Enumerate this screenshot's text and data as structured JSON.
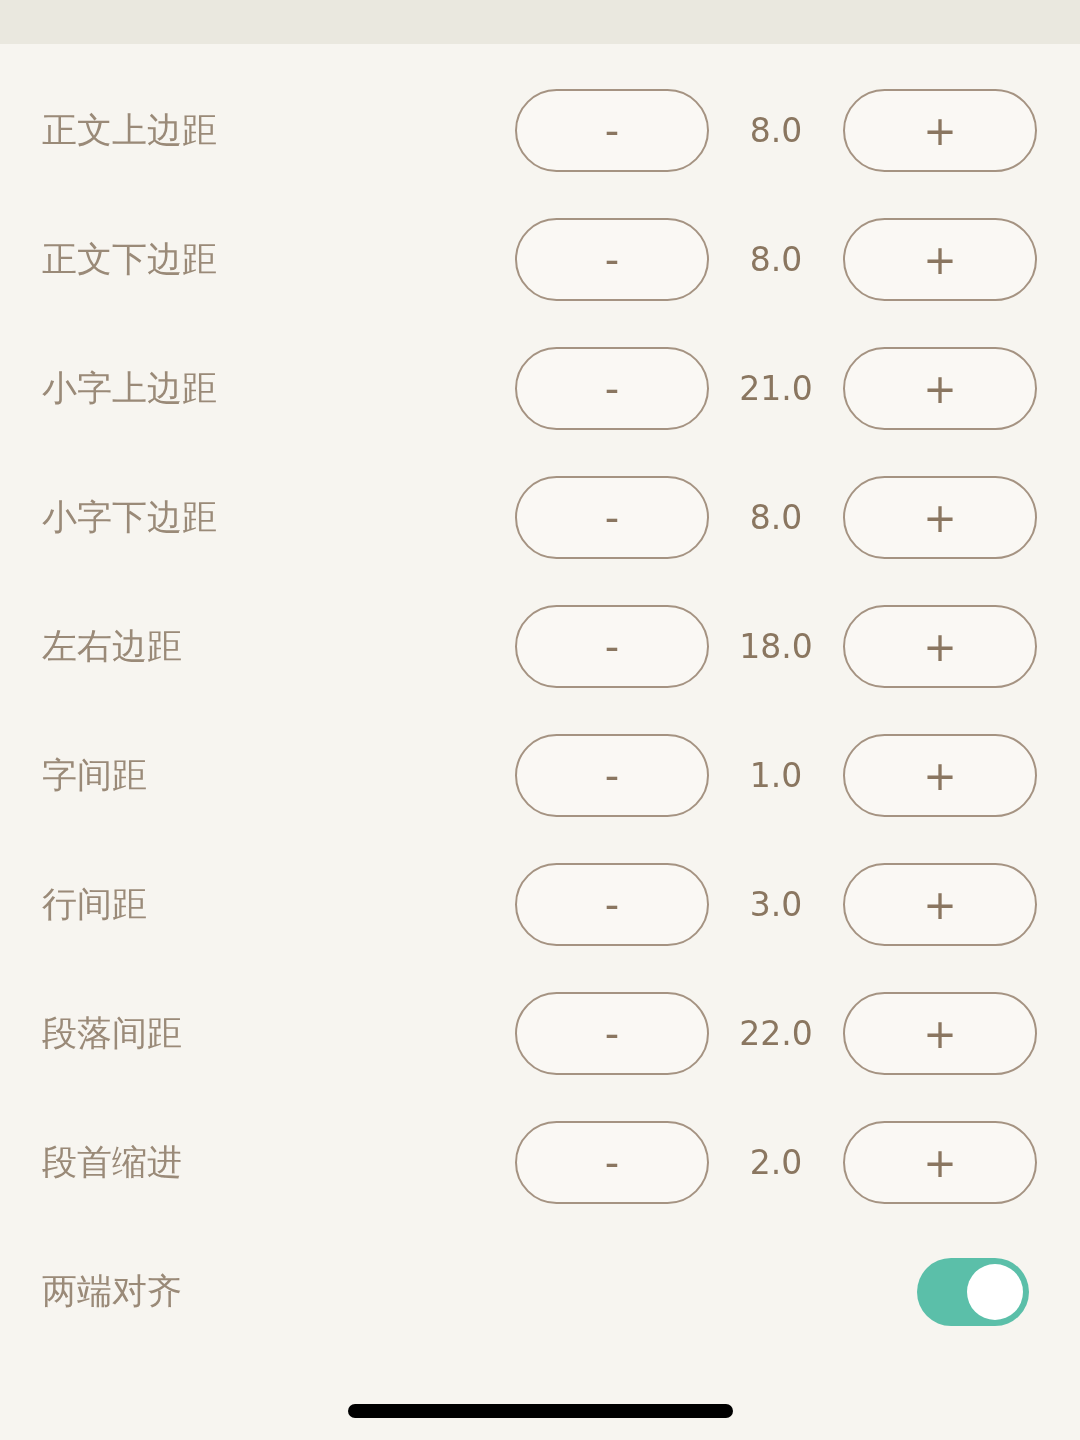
{
  "settings": [
    {
      "kind": "stepper",
      "label": "正文上边距",
      "minus": "-",
      "value": "8.0",
      "plus": "+"
    },
    {
      "kind": "stepper",
      "label": "正文下边距",
      "minus": "-",
      "value": "8.0",
      "plus": "+"
    },
    {
      "kind": "stepper",
      "label": "小字上边距",
      "minus": "-",
      "value": "21.0",
      "plus": "+"
    },
    {
      "kind": "stepper",
      "label": "小字下边距",
      "minus": "-",
      "value": "8.0",
      "plus": "+"
    },
    {
      "kind": "stepper",
      "label": "左右边距",
      "minus": "-",
      "value": "18.0",
      "plus": "+"
    },
    {
      "kind": "stepper",
      "label": "字间距",
      "minus": "-",
      "value": "1.0",
      "plus": "+"
    },
    {
      "kind": "stepper",
      "label": "行间距",
      "minus": "-",
      "value": "3.0",
      "plus": "+"
    },
    {
      "kind": "stepper",
      "label": "段落间距",
      "minus": "-",
      "value": "22.0",
      "plus": "+"
    },
    {
      "kind": "stepper",
      "label": "段首缩进",
      "minus": "-",
      "value": "2.0",
      "plus": "+"
    },
    {
      "kind": "toggle",
      "label": "两端对齐",
      "on": true
    }
  ]
}
